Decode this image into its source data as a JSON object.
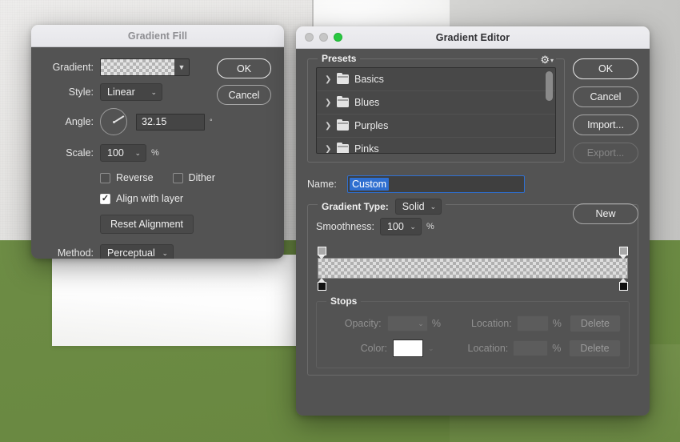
{
  "background": {
    "wall_color": "#e6e5e3",
    "green_color": "#6b8a43",
    "paper_color": "#ffffff"
  },
  "gradient_fill": {
    "title": "Gradient Fill",
    "gradient_label": "Gradient:",
    "gradient_swatch": "checkerboard-transparent",
    "style_label": "Style:",
    "style_value": "Linear",
    "angle_label": "Angle:",
    "angle_value": "32.15",
    "angle_unit": "°",
    "scale_label": "Scale:",
    "scale_value": "100",
    "scale_unit": "%",
    "reverse_label": "Reverse",
    "reverse_checked": false,
    "dither_label": "Dither",
    "dither_checked": false,
    "align_label": "Align with layer",
    "align_checked": true,
    "reset_alignment_label": "Reset Alignment",
    "method_label": "Method:",
    "method_value": "Perceptual",
    "ok_label": "OK",
    "cancel_label": "Cancel"
  },
  "gradient_editor": {
    "title": "Gradient Editor",
    "traffic_lights": [
      "close-gray",
      "minimize-gray",
      "zoom-green"
    ],
    "presets_label": "Presets",
    "presets_gear": "gear-icon",
    "presets": [
      {
        "label": "Basics"
      },
      {
        "label": "Blues"
      },
      {
        "label": "Purples"
      },
      {
        "label": "Pinks"
      }
    ],
    "name_label": "Name:",
    "name_value": "Custom",
    "gradient_type_label": "Gradient Type:",
    "gradient_type_value": "Solid",
    "smoothness_label": "Smoothness:",
    "smoothness_value": "100",
    "smoothness_unit": "%",
    "gradient_preview": "checkerboard-transparent",
    "stops": {
      "title": "Stops",
      "opacity_label": "Opacity:",
      "opacity_value": "",
      "opacity_unit": "%",
      "opacity_location_label": "Location:",
      "opacity_location_value": "",
      "opacity_location_unit": "%",
      "opacity_delete_label": "Delete",
      "color_label": "Color:",
      "color_value": "#ffffff",
      "color_location_label": "Location:",
      "color_location_value": "",
      "color_location_unit": "%",
      "color_delete_label": "Delete"
    },
    "buttons": {
      "ok": "OK",
      "cancel": "Cancel",
      "import": "Import...",
      "export": "Export...",
      "new": "New"
    }
  }
}
